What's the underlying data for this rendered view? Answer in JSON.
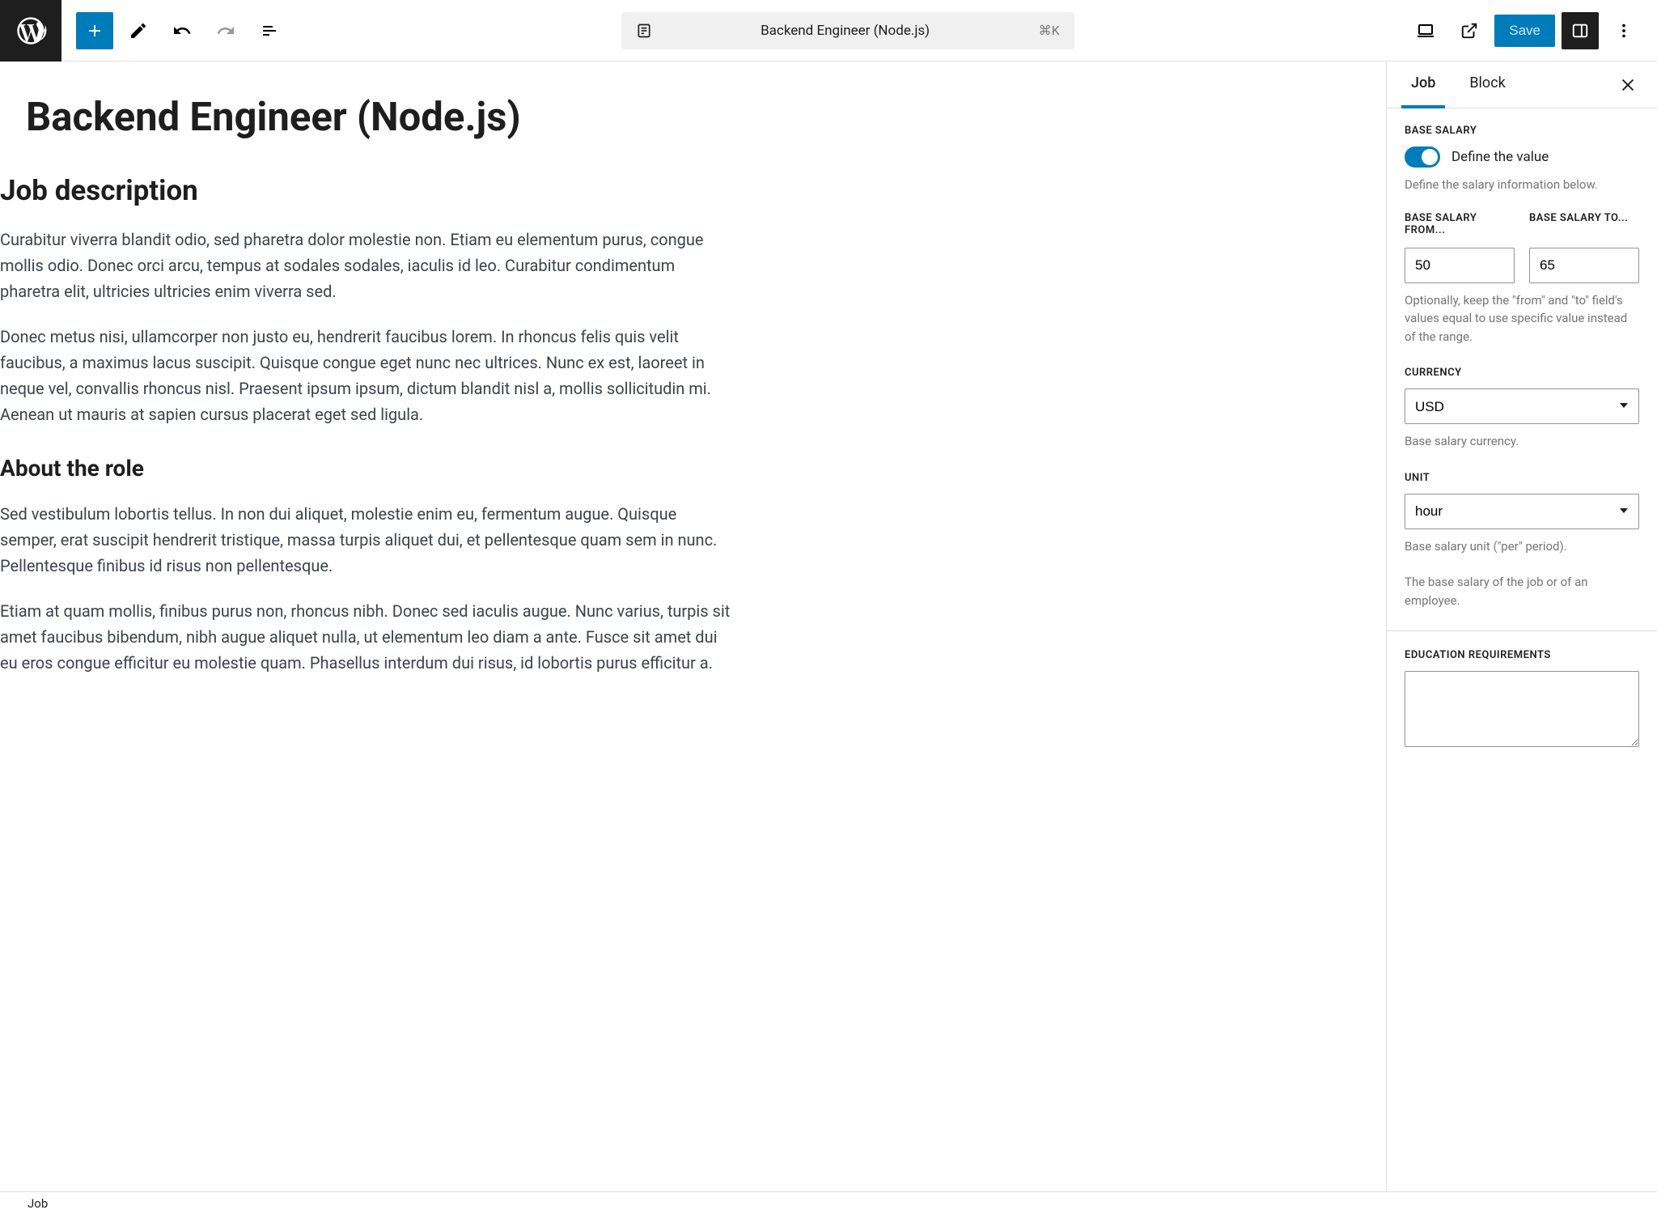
{
  "toolbar": {
    "doc_title": "Backend Engineer (Node.js)",
    "shortcut": "⌘K",
    "save_label": "Save"
  },
  "editor": {
    "title": "Backend Engineer (Node.js)",
    "h2_1": "Job description",
    "p1": "Curabitur viverra blandit odio, sed pharetra dolor molestie non. Etiam eu elementum purus, congue mollis odio. Donec orci arcu, tempus at sodales sodales, iaculis id leo. Curabitur condimentum pharetra elit, ultricies ultricies enim viverra sed.",
    "p2": "Donec metus nisi, ullamcorper non justo eu, hendrerit faucibus lorem. In rhoncus felis quis velit faucibus, a maximus lacus suscipit. Quisque congue eget nunc nec ultrices. Nunc ex est, laoreet in neque vel, convallis rhoncus nisl. Praesent ipsum ipsum, dictum blandit nisl a, mollis sollicitudin mi. Aenean ut mauris at sapien cursus placerat eget sed ligula.",
    "h3_1": "About the role",
    "p3": "Sed vestibulum lobortis tellus. In non dui aliquet, molestie enim eu, fermentum augue. Quisque semper, erat suscipit hendrerit tristique, massa turpis aliquet dui, et pellentesque quam sem in nunc. Pellentesque finibus id risus non pellentesque.",
    "p4": "Etiam at quam mollis, finibus purus non, rhoncus nibh. Donec sed iaculis augue. Nunc varius, turpis sit amet faucibus bibendum, nibh augue aliquet nulla, ut elementum leo diam a ante. Fusce sit amet dui eu eros congue efficitur eu molestie quam. Phasellus interdum dui risus, id lobortis purus efficitur a."
  },
  "sidebar": {
    "tabs": {
      "job": "Job",
      "block": "Block"
    },
    "base_salary": {
      "label": "BASE SALARY",
      "toggle_label": "Define the value",
      "help": "Define the salary information below.",
      "from_label": "BASE SALARY FROM...",
      "from_value": "50",
      "to_label": "BASE SALARY TO...",
      "to_value": "65",
      "range_help": "Optionally, keep the \"from\" and \"to\" field's values equal to use specific value instead of the range."
    },
    "currency": {
      "label": "CURRENCY",
      "value": "USD",
      "help": "Base salary currency."
    },
    "unit": {
      "label": "UNIT",
      "value": "hour",
      "help": "Base salary unit (\"per\" period).",
      "extra_help": "The base salary of the job or of an employee."
    },
    "education": {
      "label": "EDUCATION REQUIREMENTS",
      "value": ""
    }
  },
  "statusbar": {
    "breadcrumb": "Job"
  }
}
